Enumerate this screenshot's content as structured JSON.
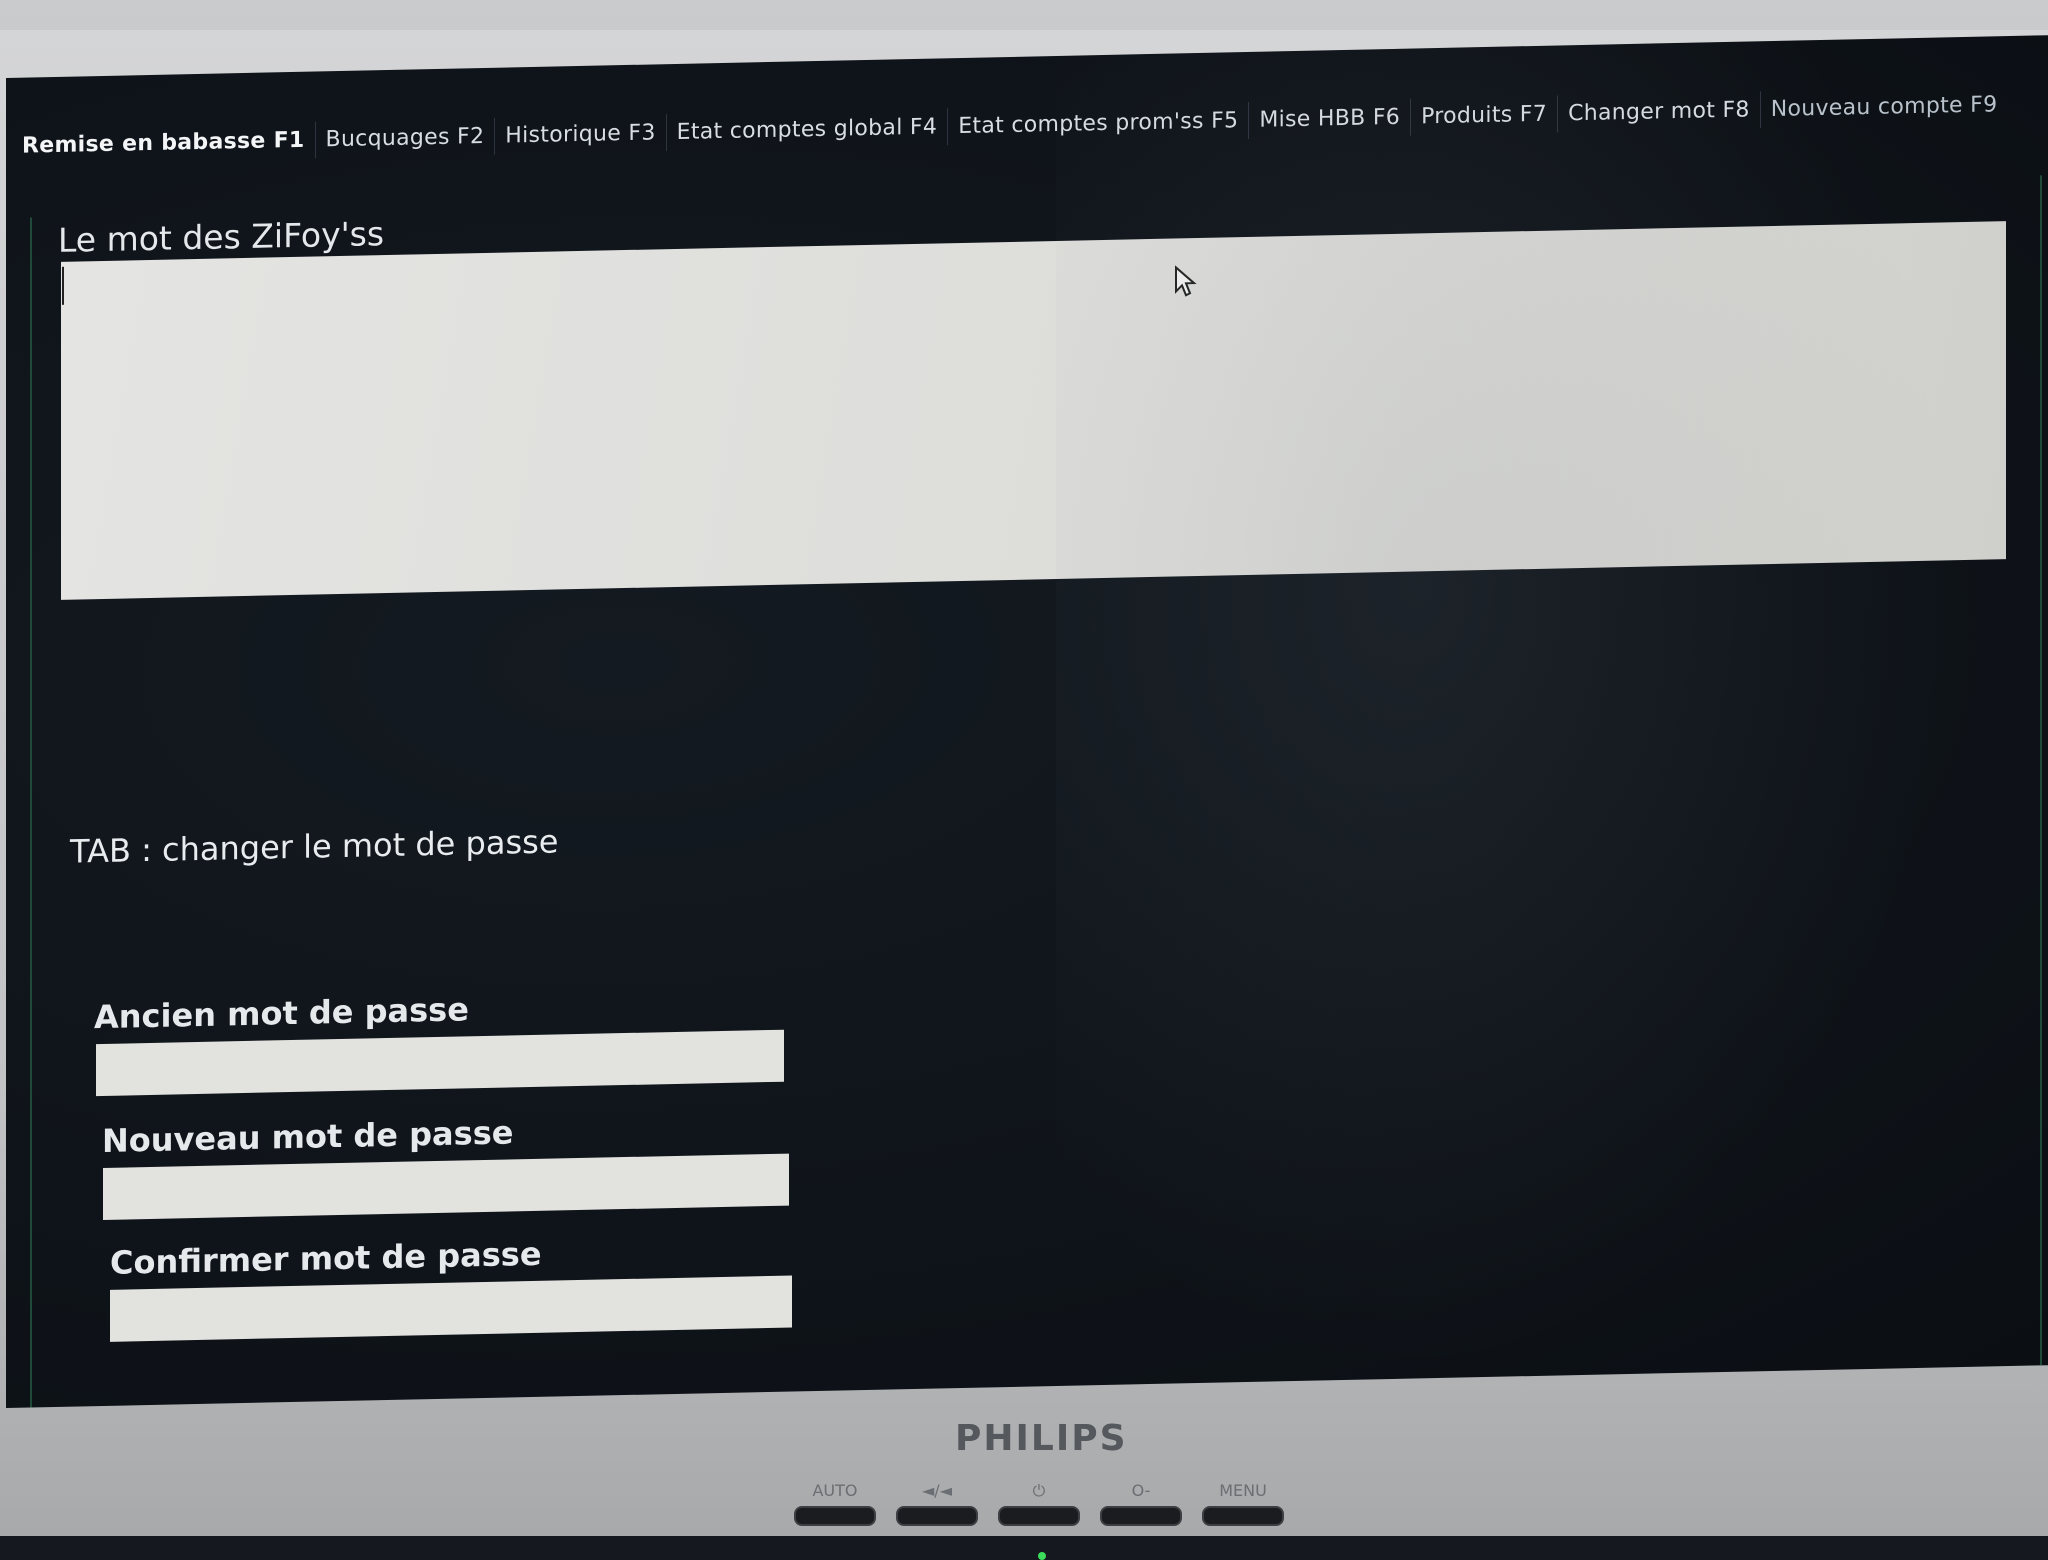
{
  "tabs": [
    {
      "label": "Remise en babasse F1",
      "active": true
    },
    {
      "label": "Bucquages F2"
    },
    {
      "label": "Historique F3"
    },
    {
      "label": "Etat comptes global F4"
    },
    {
      "label": "Etat comptes prom'ss F5"
    },
    {
      "label": "Mise HBB F6"
    },
    {
      "label": "Produits F7"
    },
    {
      "label": "Changer mot F8"
    },
    {
      "label": "Nouveau compte F9"
    }
  ],
  "main": {
    "mot_title": "Le mot des ZiFoy'ss",
    "mot_value": "",
    "tab_hint": "TAB : changer le mot de passe"
  },
  "password_form": {
    "old_label": "Ancien mot de passe",
    "old_value": "",
    "new_label": "Nouveau mot de passe",
    "new_value": "",
    "confirm_label": "Confirmer mot de passe",
    "confirm_value": ""
  },
  "monitor": {
    "brand": "PHILIPS",
    "buttons": [
      "AUTO",
      "◄/◄",
      "⏻",
      "O-",
      "MENU"
    ]
  },
  "colors": {
    "screen_bg": "#0f141a",
    "text": "#e6e9ec",
    "field_bg": "#e2e2df",
    "frame_border": "#1f4a3a"
  },
  "icons": [
    "mouse-pointer-icon"
  ]
}
